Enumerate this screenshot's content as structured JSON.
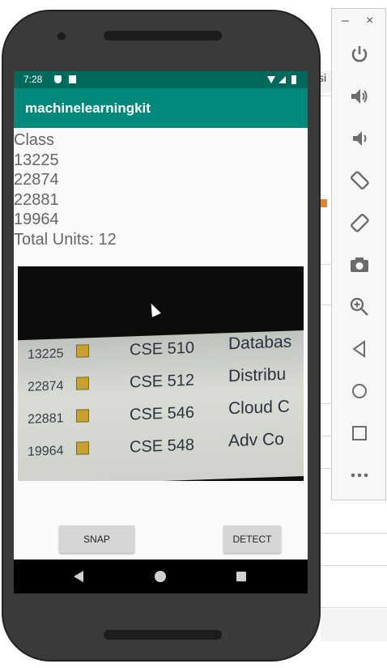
{
  "status_bar": {
    "time": "7:28"
  },
  "app": {
    "title": "machinelearningkit"
  },
  "results": {
    "header": "Class",
    "codes": [
      "13225",
      "22874",
      "22881",
      "19964"
    ],
    "total": "Total Units: 12"
  },
  "camera_preview": {
    "rows": [
      {
        "num": "13225",
        "course": "CSE 510",
        "title": "Databas"
      },
      {
        "num": "22874",
        "course": "CSE 512",
        "title": "Distribu"
      },
      {
        "num": "22881",
        "course": "CSE 546",
        "title": "Cloud C"
      },
      {
        "num": "19964",
        "course": "CSE 548",
        "title": "Adv Co"
      }
    ]
  },
  "buttons": {
    "snap": "SNAP",
    "detect": "DETECT"
  },
  "background_app": {
    "fragment_text": "si"
  },
  "emulator_toolbar": {
    "window_controls": {
      "minimize": "–",
      "close": "×"
    },
    "icons": [
      "power-icon",
      "volume-up-icon",
      "volume-down-icon",
      "rotate-left-icon",
      "rotate-right-icon",
      "camera-icon",
      "zoom-in-icon",
      "back-icon",
      "home-icon",
      "overview-icon",
      "more-icon"
    ]
  },
  "colors": {
    "status_bar": "#00695c",
    "app_bar": "#00897b",
    "result_text": "#666666"
  }
}
